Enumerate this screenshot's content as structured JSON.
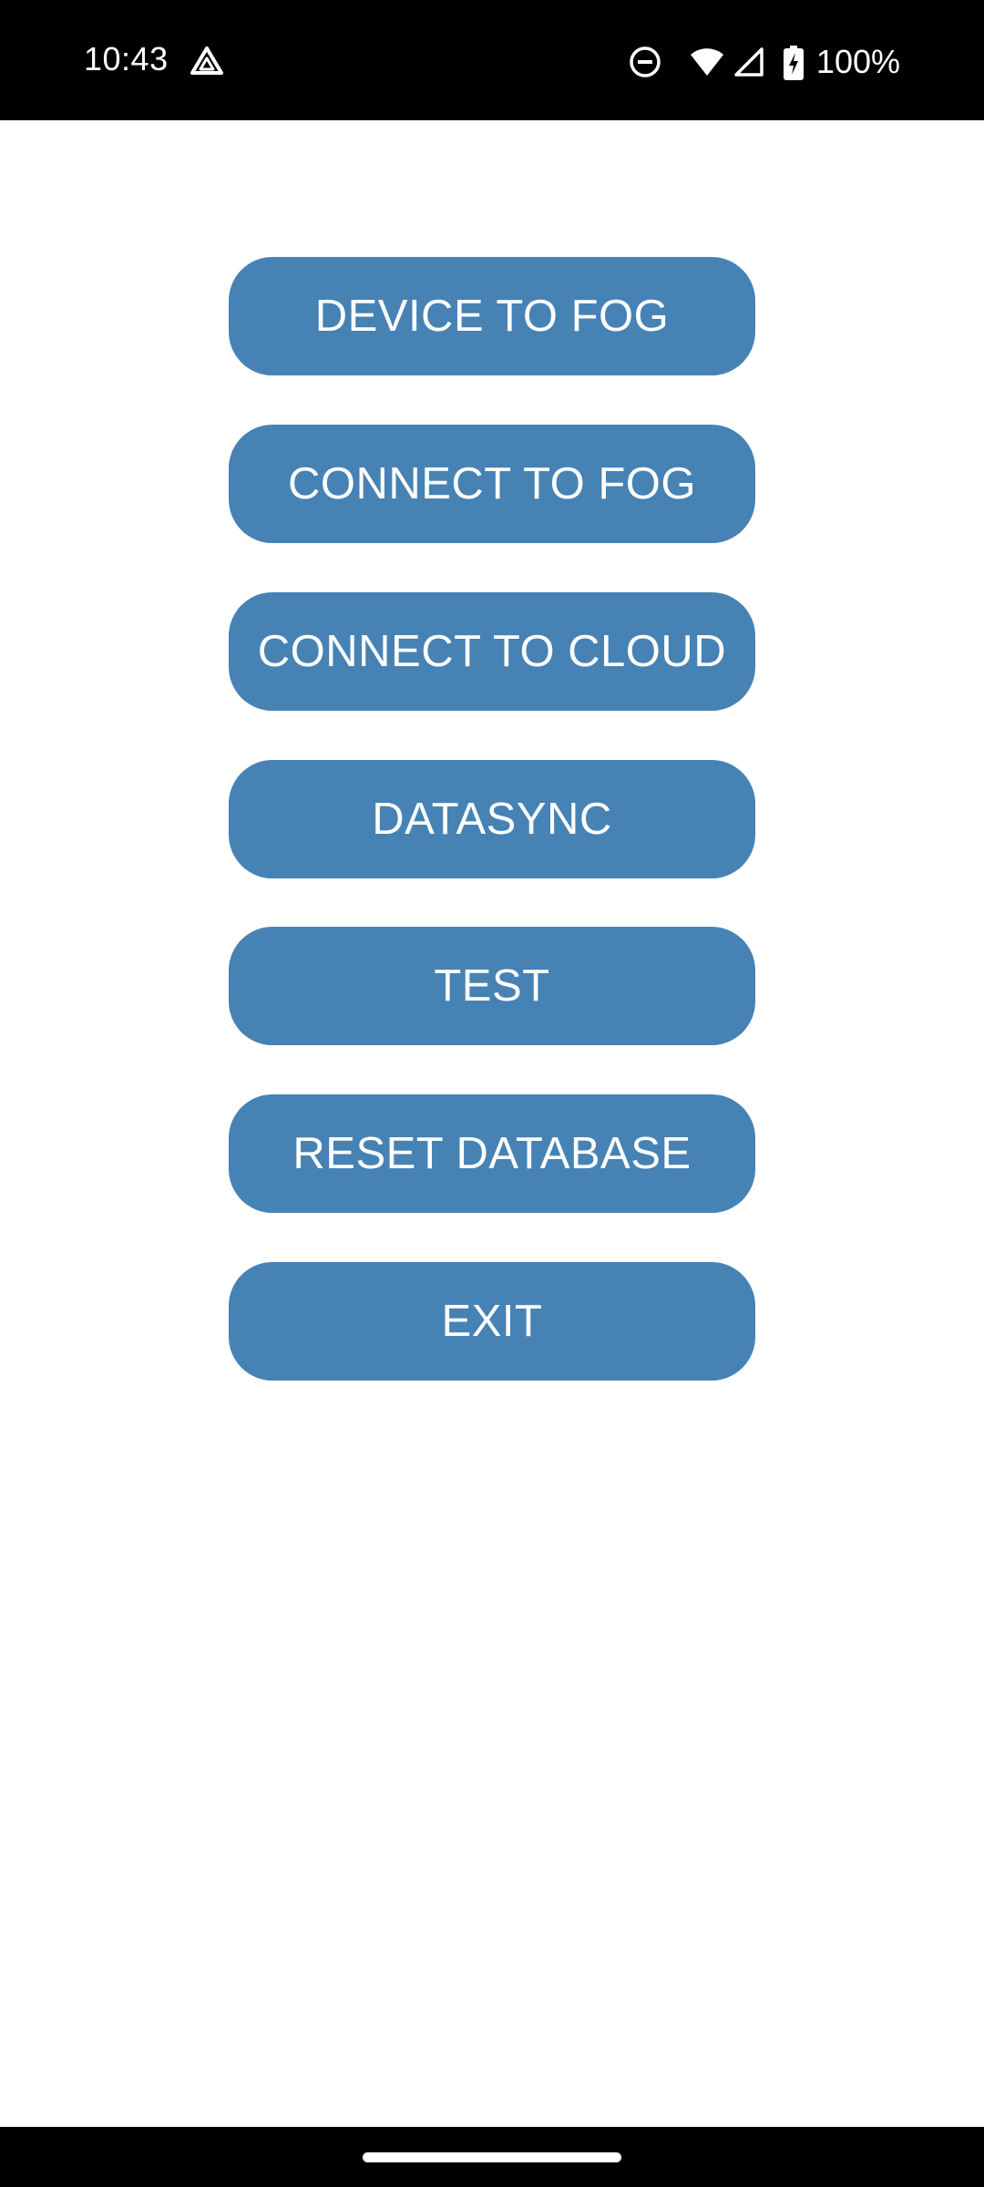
{
  "status_bar": {
    "time": "10:43",
    "battery": "100%",
    "icons": [
      "drive-icon",
      "dnd-icon",
      "wifi-icon",
      "cell-signal-icon",
      "battery-charging-icon"
    ]
  },
  "buttons": [
    {
      "label": "DEVICE TO FOG"
    },
    {
      "label": "CONNECT TO FOG"
    },
    {
      "label": "CONNECT TO CLOUD"
    },
    {
      "label": "DATASYNC"
    },
    {
      "label": "TEST"
    },
    {
      "label": "RESET DATABASE"
    },
    {
      "label": "EXIT"
    }
  ],
  "colors": {
    "button_bg": "#4682b4",
    "button_text": "#ffffff",
    "status_bar_bg": "#000000",
    "background": "#ffffff"
  }
}
